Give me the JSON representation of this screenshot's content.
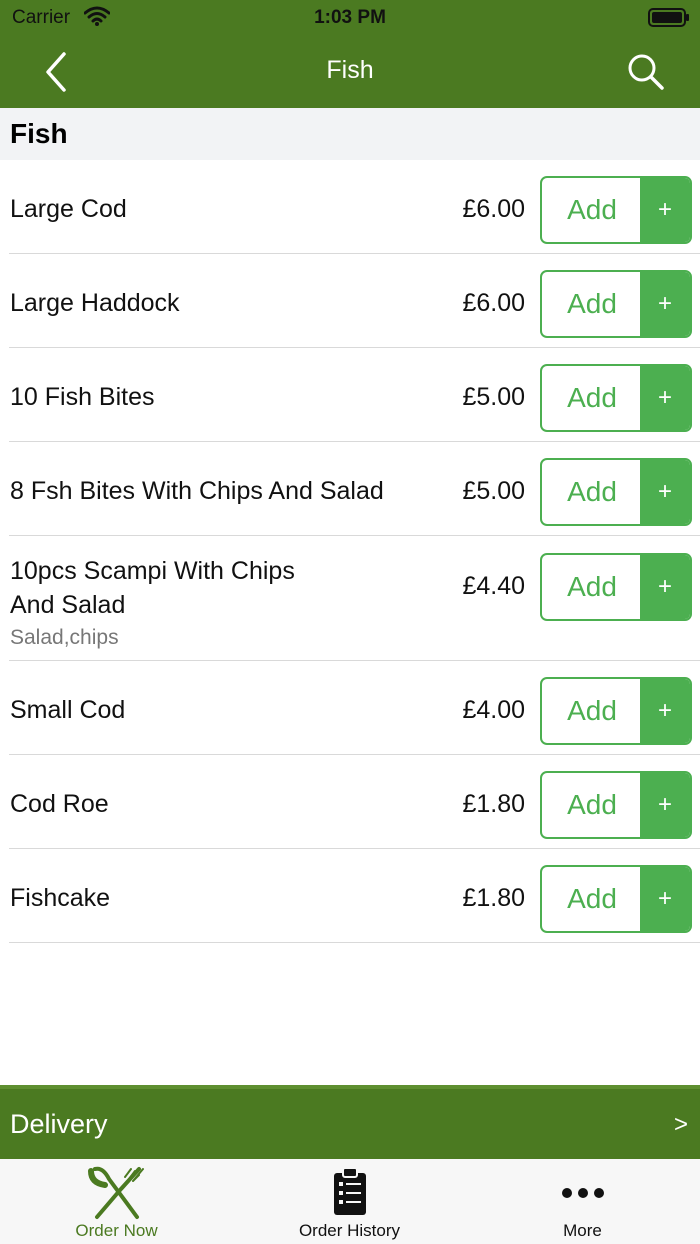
{
  "status_bar": {
    "carrier": "Carrier",
    "time": "1:03 PM"
  },
  "nav": {
    "title": "Fish",
    "back_icon": "chevron-left-icon",
    "search_icon": "search-icon"
  },
  "section": {
    "title": "Fish"
  },
  "items": [
    {
      "name": "Large Cod",
      "price": "£6.00",
      "description": "",
      "add_label": "Add",
      "plus_label": "+"
    },
    {
      "name": "Large Haddock",
      "price": "£6.00",
      "description": "",
      "add_label": "Add",
      "plus_label": "+"
    },
    {
      "name": "10 Fish Bites",
      "price": "£5.00",
      "description": "",
      "add_label": "Add",
      "plus_label": "+"
    },
    {
      "name": "8 Fsh Bites With Chips And Salad",
      "price": "£5.00",
      "description": "",
      "add_label": "Add",
      "plus_label": "+"
    },
    {
      "name": "10pcs Scampi With Chips And Salad",
      "price": "£4.40",
      "description": "Salad,chips",
      "add_label": "Add",
      "plus_label": "+"
    },
    {
      "name": "Small Cod",
      "price": "£4.00",
      "description": "",
      "add_label": "Add",
      "plus_label": "+"
    },
    {
      "name": "Cod Roe",
      "price": "£1.80",
      "description": "",
      "add_label": "Add",
      "plus_label": "+"
    },
    {
      "name": "Fishcake",
      "price": "£1.80",
      "description": "",
      "add_label": "Add",
      "plus_label": "+"
    }
  ],
  "delivery": {
    "label": "Delivery",
    "arrow": ">"
  },
  "tabs": [
    {
      "label": "Order Now",
      "icon": "fork-knife-icon",
      "active": true
    },
    {
      "label": "Order History",
      "icon": "clipboard-icon",
      "active": false
    },
    {
      "label": "More",
      "icon": "more-dots-icon",
      "active": false
    }
  ],
  "colors": {
    "header": "#4b7a21",
    "accent": "#4caf50"
  }
}
